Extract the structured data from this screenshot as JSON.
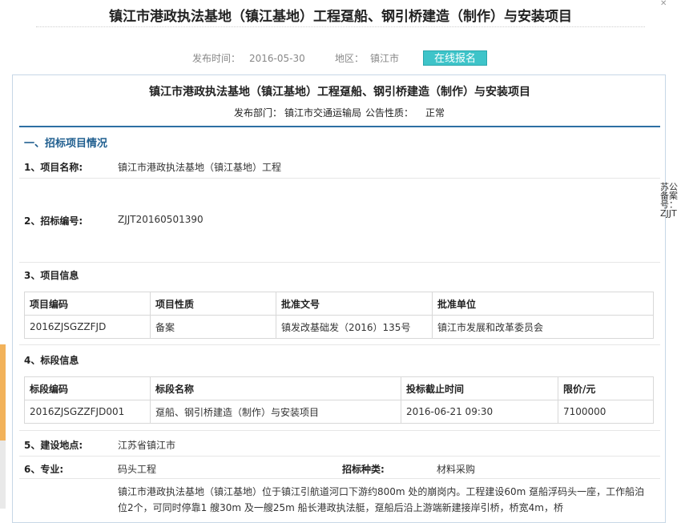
{
  "page": {
    "title": "镇江市港政执法基地（镇江基地）工程趸船、钢引桥建造（制作）与安装项目",
    "meta": {
      "publish_label": "发布时间：",
      "publish_date": "2016-05-30",
      "region_label": "地区：",
      "region": "镇江市",
      "signup_button": "在线报名"
    }
  },
  "panel": {
    "title": "镇江市港政执法基地（镇江基地）工程趸船、钢引桥建造（制作）与安装项目",
    "dept_label": "发布部门：",
    "dept": "镇江市交通运输局",
    "nature_label": "公告性质：",
    "nature": "正常",
    "section1": "一、招标项目情况",
    "rows": {
      "name_label": "1、项目名称:",
      "name_value": "镇江市港政执法基地（镇江基地）工程",
      "code_label": "2、招标编号:",
      "code_value": "ZJJT20160501390",
      "info_label": "3、项目信息",
      "section_label": "4、标段信息",
      "site_label": "5、建设地点:",
      "site_value": "江苏省镇江市",
      "major_label": "6、专业:",
      "major_value": "码头工程",
      "kind_label": "招标种类:",
      "kind_value": "材料采购"
    },
    "project_table": {
      "headers": [
        "项目编码",
        "项目性质",
        "批准文号",
        "批准单位"
      ],
      "row": [
        "2016ZJSGZZFJD",
        "备案",
        "镇发改基础发（2016）135号",
        "镇江市发展和改革委员会"
      ]
    },
    "section_table": {
      "headers": [
        "标段编码",
        "标段名称",
        "投标截止时间",
        "限价/元"
      ],
      "row": [
        "2016ZJSGZZFJD001",
        "趸船、钢引桥建造（制作）与安装项目",
        "2016-06-21 09:30",
        "7100000"
      ]
    },
    "description": "镇江市港政执法基地（镇江基地）位于镇江引航道河口下游约800m 处的崩岗内。工程建设60m 趸船浮码头一座，工作船泊位2个，可同时停靠1 艘30m 及一艘25m 船长港政执法艇，趸船后沿上游端新建接岸引桥，桥宽4m，桥"
  },
  "side_note": "苏公备案号：ZJJT"
}
